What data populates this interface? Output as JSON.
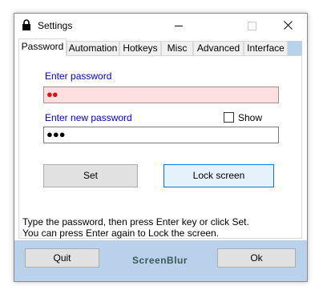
{
  "window": {
    "title": "Settings"
  },
  "tabs": [
    "Password",
    "Automation",
    "Hotkeys",
    "Misc",
    "Advanced",
    "Interface"
  ],
  "active_tab": "Password",
  "password_panel": {
    "password_label": "Enter password",
    "password_value": "●●",
    "show_label": "Show",
    "show_checked": false,
    "new_password_label": "Enter new password",
    "new_password_value": "●●●",
    "set_button": "Set",
    "lock_button": "Lock screen",
    "info_line1": "Type the password, then press Enter key or click Set.",
    "info_line2": "You can press Enter again to Lock the screen."
  },
  "footer": {
    "quit_button": "Quit",
    "brand": "ScreenBlur",
    "ok_button": "Ok"
  }
}
